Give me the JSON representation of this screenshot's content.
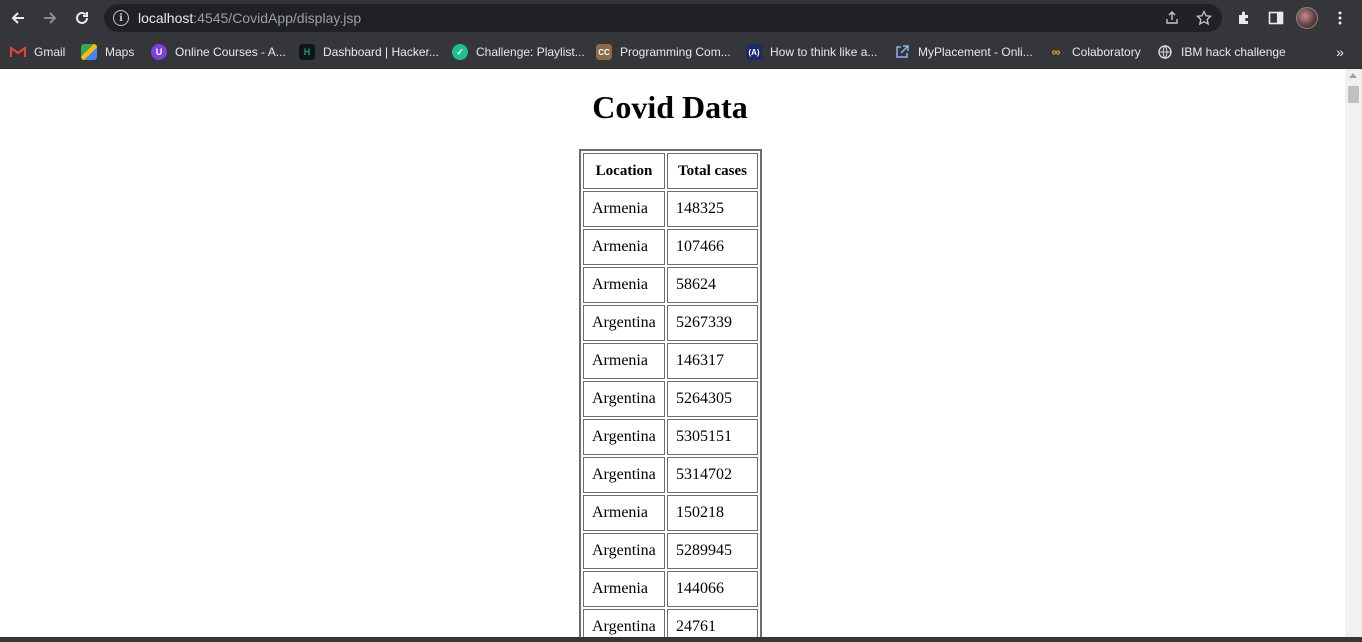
{
  "browser": {
    "url_host": "localhost",
    "url_rest": ":4545/CovidApp/display.jsp"
  },
  "bookmarks": [
    {
      "label": "Gmail",
      "icon": "gmail-icon",
      "color": "#ea4335"
    },
    {
      "label": "Maps",
      "icon": "maps-icon",
      "color": "#34a853"
    },
    {
      "label": "Online Courses - A...",
      "icon": "online-courses-icon",
      "color": "#7b3fe4"
    },
    {
      "label": "Dashboard | Hacker...",
      "icon": "hackerrank-icon",
      "color": "#1ba94c"
    },
    {
      "label": "Challenge: Playlist...",
      "icon": "challenge-icon",
      "color": "#1fbf8f"
    },
    {
      "label": "Programming Com...",
      "icon": "codechef-icon",
      "color": "#8b6b4a"
    },
    {
      "label": "How to think like a...",
      "icon": "runestone-icon",
      "color": "#1c2a6b"
    },
    {
      "label": "MyPlacement - Onli...",
      "icon": "external-link-icon",
      "color": "#8ab4f8"
    },
    {
      "label": "Colaboratory",
      "icon": "colab-icon",
      "color": "#f9ab00"
    },
    {
      "label": "IBM hack challenge",
      "icon": "globe-icon",
      "color": "#dadce0"
    }
  ],
  "page": {
    "title": "Covid Data",
    "columns": [
      "Location",
      "Total cases"
    ],
    "rows": [
      {
        "location": "Armenia",
        "total_cases": "148325"
      },
      {
        "location": "Armenia",
        "total_cases": "107466"
      },
      {
        "location": "Armenia",
        "total_cases": "58624"
      },
      {
        "location": "Argentina",
        "total_cases": "5267339"
      },
      {
        "location": "Armenia",
        "total_cases": "146317"
      },
      {
        "location": "Argentina",
        "total_cases": "5264305"
      },
      {
        "location": "Argentina",
        "total_cases": "5305151"
      },
      {
        "location": "Argentina",
        "total_cases": "5314702"
      },
      {
        "location": "Armenia",
        "total_cases": "150218"
      },
      {
        "location": "Argentina",
        "total_cases": "5289945"
      },
      {
        "location": "Armenia",
        "total_cases": "144066"
      },
      {
        "location": "Argentina",
        "total_cases": "24761"
      }
    ]
  }
}
